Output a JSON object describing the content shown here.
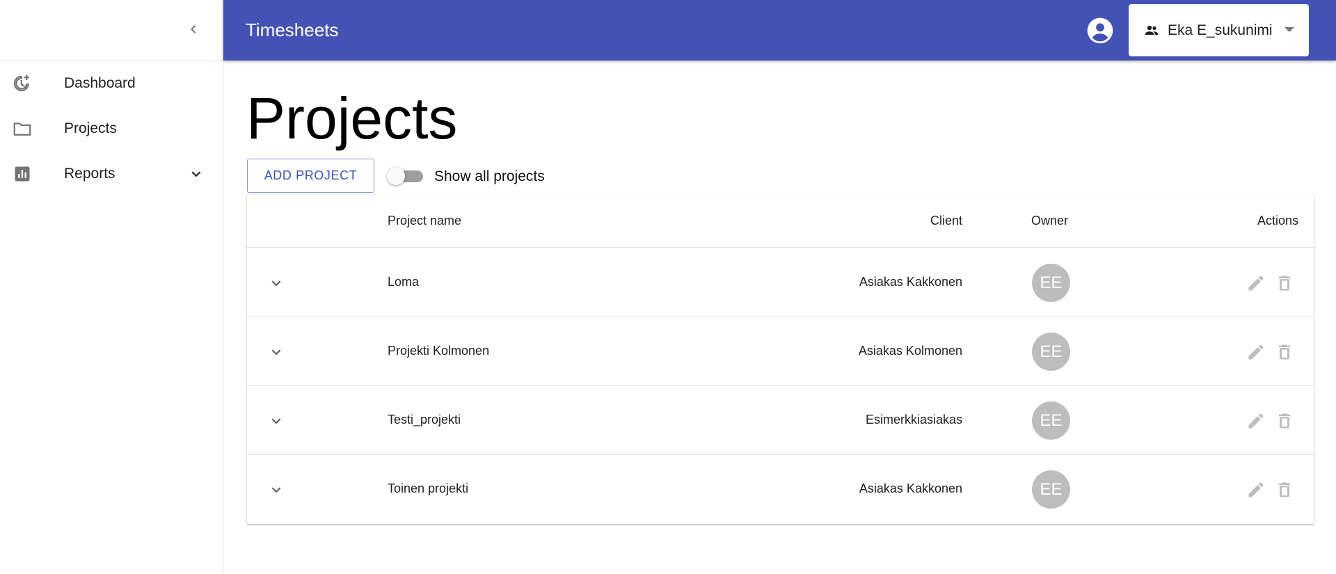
{
  "app": {
    "title": "Timesheets"
  },
  "sidebar": {
    "items": [
      {
        "label": "Dashboard",
        "icon": "dashboard-icon"
      },
      {
        "label": "Projects",
        "icon": "folder-icon"
      },
      {
        "label": "Reports",
        "icon": "bar-chart-icon"
      }
    ]
  },
  "header": {
    "user_name": "Eka E_sukunimi"
  },
  "main": {
    "page_title": "Projects",
    "add_button_label": "ADD PROJECT",
    "toggle_label": "Show all projects",
    "toggle_on": false
  },
  "table": {
    "headers": {
      "project_name": "Project name",
      "client": "Client",
      "owner": "Owner",
      "actions": "Actions"
    },
    "rows": [
      {
        "project_name": "Loma",
        "client": "Asiakas Kakkonen",
        "owner_initials": "EE"
      },
      {
        "project_name": "Projekti Kolmonen",
        "client": "Asiakas Kolmonen",
        "owner_initials": "EE"
      },
      {
        "project_name": "Testi_projekti",
        "client": "Esimerkkiasiakas",
        "owner_initials": "EE"
      },
      {
        "project_name": "Toinen projekti",
        "client": "Asiakas Kakkonen",
        "owner_initials": "EE"
      }
    ]
  },
  "colors": {
    "appbar": "#4552b5",
    "primary": "#3f51b5",
    "avatar": "#bdbdbd",
    "icon_muted": "#bdbdbd"
  }
}
